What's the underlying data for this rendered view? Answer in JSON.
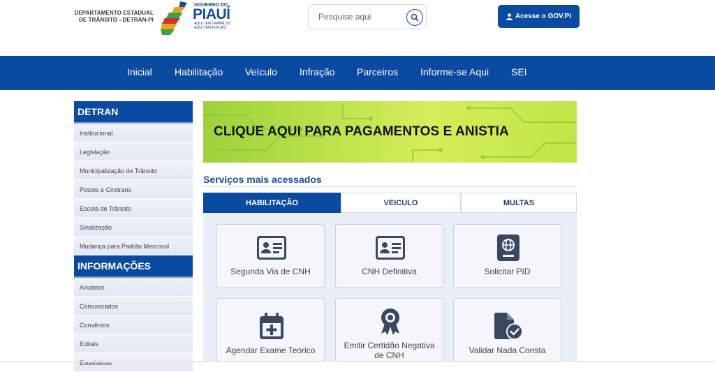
{
  "header": {
    "dept_line1": "DEPARTAMENTO ESTADUAL",
    "dept_line2": "DE TRÂNSITO - DETRAN-PI",
    "gov_small": "GOVERNO DO",
    "gov_big": "PIAUÍ",
    "gov_slogan1": "AQUI TEM TRABALHO.",
    "gov_slogan2": "AQUI TEM FUTURO.",
    "search_placeholder": "Pesquise aqui",
    "gov_button": "Acesse o GOV.PI"
  },
  "nav": {
    "items": [
      "Inicial",
      "Habilitação",
      "Veículo",
      "Infração",
      "Parceiros",
      "Informe-se Aqui",
      "SEI"
    ]
  },
  "sidebar": {
    "sections": [
      {
        "title": "DETRAN",
        "items": [
          "Institucional",
          "Legislação",
          "Municipalização de Trânsito",
          "Postos e Ciretrans",
          "Escola de Trânsito",
          "Sinalização",
          "Mudança para Padrão Mercosul"
        ]
      },
      {
        "title": "INFORMAÇÕES",
        "items": [
          "Anuários",
          "Comunicados",
          "Convênios",
          "Editais",
          "Estatísticas"
        ]
      }
    ]
  },
  "banner": {
    "text": "CLIQUE AQUI PARA PAGAMENTOS E ANISTIA"
  },
  "services": {
    "title": "Serviços mais acessados",
    "tabs": [
      "HABILITAÇÃO",
      "VEICULO",
      "MULTAS"
    ],
    "active_tab": "HABILITAÇÃO",
    "cards": [
      {
        "label": "Segunda Via de CNH",
        "icon": "id-card-icon"
      },
      {
        "label": "CNH Definitiva",
        "icon": "id-card-icon"
      },
      {
        "label": "Solicitar PID",
        "icon": "passport-icon"
      },
      {
        "label": "Agendar Exame Teórico",
        "icon": "calendar-plus-icon"
      },
      {
        "label": "Emitir Certidão Negativa de CNH",
        "icon": "award-icon"
      },
      {
        "label": "Validar Nada Consta",
        "icon": "file-check-icon"
      }
    ]
  },
  "colors": {
    "primary": "#0b4aa1",
    "banner_green": "#b9e04a",
    "icon_dark": "#3a4760"
  }
}
